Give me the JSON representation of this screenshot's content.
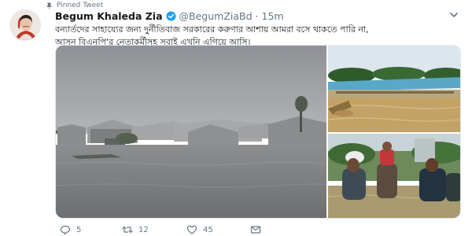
{
  "pinned_label": "Pinned Tweet",
  "author": {
    "name": "Begum Khaleda Zia",
    "handle": "@BegumZiaBd",
    "separator": "·",
    "time": "15m"
  },
  "tweet_text": {
    "line1": "বন্যার্তদের সাহায্যের জন্য দুর্নীতিবাজ সরকারের করুণার আশায় আমরা বসে থাকতে পারি না,",
    "line2": "আসুন বিএনপি'র নেতাকর্মীসহ সবাই এখনি এগিয়ে আসি।"
  },
  "stats": {
    "replies": "5",
    "retweets": "12",
    "likes": "45"
  },
  "colors": {
    "verified": "#1da1f2",
    "muted": "#657786"
  },
  "icons": [
    "pin-icon",
    "verified-icon",
    "chevron-down-icon",
    "reply-icon",
    "retweet-icon",
    "like-icon",
    "message-icon"
  ]
}
